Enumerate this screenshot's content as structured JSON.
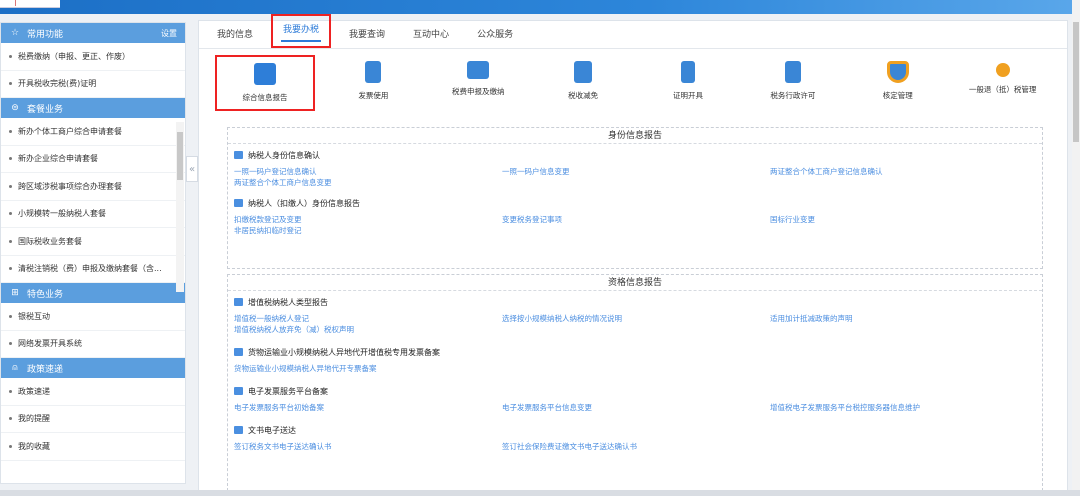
{
  "sidebar": {
    "sections": [
      {
        "title": "常用功能",
        "right": "设置",
        "items": [
          "税费缴纳（申报、更正、作废）",
          "开具税收完税(费)证明"
        ]
      },
      {
        "title": "套餐业务",
        "items": [
          "新办个体工商户综合申请套餐",
          "新办企业综合申请套餐",
          "跨区域涉税事项综合办理套餐",
          "小规模转一般纳税人套餐",
          "国际税收业务套餐",
          "清税注销税（费）申报及缴纳套餐（含..."
        ]
      },
      {
        "title": "特色业务",
        "items": [
          "银税互动",
          "网络发票开具系统"
        ]
      },
      {
        "title": "政策速递",
        "items": [
          "政策速递",
          "我的提醒",
          "我的收藏"
        ]
      }
    ],
    "collapse_icon": "«"
  },
  "tabs": [
    "我的信息",
    "我要办税",
    "我要查询",
    "互动中心",
    "公众服务"
  ],
  "active_tab": "我要办税",
  "icons": [
    {
      "label": "综合信息报告",
      "color": "#2e7ed8"
    },
    {
      "label": "发票使用",
      "color": "#3a86d6"
    },
    {
      "label": "税费申报及缴纳",
      "color": "#3a86d6"
    },
    {
      "label": "税收减免",
      "color": "#3a86d6"
    },
    {
      "label": "证明开具",
      "color": "#3a86d6"
    },
    {
      "label": "税务行政许可",
      "color": "#3a86d6"
    },
    {
      "label": "核定管理",
      "color": "#f0a020"
    },
    {
      "label": "一般退（抵）税管理",
      "color": "#f0a020"
    }
  ],
  "sections": [
    {
      "title": "身份信息报告",
      "groups": [
        {
          "title": "纳税人身份信息确认",
          "links": [
            "一照一码户登记信息确认",
            "一照一码户信息变更",
            "两证整合个体工商户登记信息确认",
            "两证整合个体工商户信息变更"
          ]
        },
        {
          "title": "纳税人（扣缴人）身份信息报告",
          "links": [
            "扣缴税款登记及变更",
            "变更税务登记事项",
            "国标行业变更",
            "非居民纳扣临时登记"
          ]
        }
      ]
    },
    {
      "title": "资格信息报告",
      "groups": [
        {
          "title": "增值税纳税人类型报告",
          "links": [
            "增值税一般纳税人登记",
            "选择按小规模纳税人纳税的情况说明",
            "适用加计抵减政策的声明",
            "增值税纳税人放弃免（减）税权声明"
          ]
        },
        {
          "title": "货物运输业小规模纳税人异地代开增值税专用发票备案",
          "links": [
            "货物运输业小规模纳税人异地代开专票备案"
          ]
        },
        {
          "title": "电子发票服务平台备案",
          "links": [
            "电子发票服务平台初始备案",
            "电子发票服务平台信息变更",
            "增值税电子发票服务平台税控服务器信息维护"
          ]
        },
        {
          "title": "文书电子送达",
          "links": [
            "签订税务文书电子送达确认书",
            "签订社会保险费证缴文书电子送达确认书"
          ]
        }
      ]
    }
  ]
}
